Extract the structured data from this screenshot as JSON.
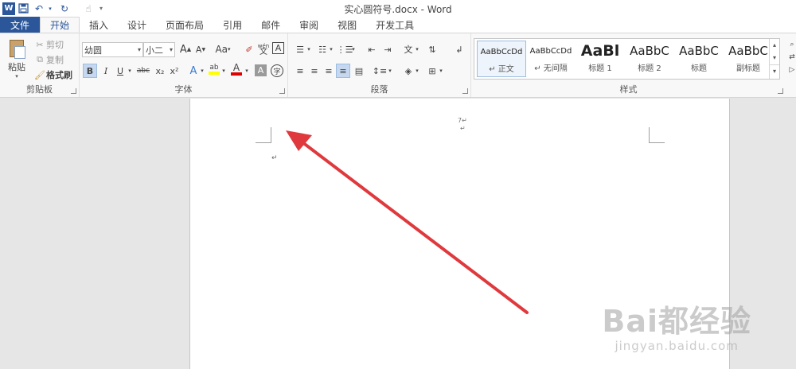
{
  "window": {
    "title": "实心圆符号.docx - Word",
    "qat": {
      "app_icon": "W",
      "save_icon": "save-icon",
      "undo_icon": "undo-icon",
      "redo_icon": "redo-icon",
      "touch_icon": "touch-mode-icon",
      "customize_icon": "customize-qat-icon"
    }
  },
  "tabs": [
    "文件",
    "开始",
    "插入",
    "设计",
    "页面布局",
    "引用",
    "邮件",
    "审阅",
    "视图",
    "开发工具"
  ],
  "active_tab": "开始",
  "clipboard": {
    "paste_label": "粘贴",
    "cut_label": "剪切",
    "copy_label": "复制",
    "format_painter_label": "格式刷",
    "group_label": "剪贴板"
  },
  "font": {
    "font_name": "幼圆",
    "font_size": "小二",
    "group_label": "字体",
    "grow_label": "A",
    "shrink_label": "A",
    "case_label": "Aa",
    "bold": "B",
    "italic": "I",
    "underline": "U",
    "strike": "abc",
    "subscript": "x₂",
    "superscript": "x²",
    "text_effect": "A",
    "highlight": "ab",
    "font_color": "A",
    "char_shading": "A",
    "phonetic_top": "wén",
    "phonetic_bottom": "文",
    "border_char": "A",
    "enclose_char": "字"
  },
  "paragraph": {
    "group_label": "段落"
  },
  "styles": {
    "group_label": "样式",
    "items": [
      {
        "sample": "AaBbCcDd",
        "name": "↵ 正文"
      },
      {
        "sample": "AaBbCcDd",
        "name": "↵ 无间隔"
      },
      {
        "sample": "AaBl",
        "name": "标题 1"
      },
      {
        "sample": "AaBbC",
        "name": "标题 2"
      },
      {
        "sample": "AaBbC",
        "name": "标题"
      },
      {
        "sample": "AaBbC",
        "name": "副标题"
      }
    ]
  },
  "document": {
    "header_mark": "7↵",
    "header_mark2": "↵",
    "para_mark": "↵"
  },
  "watermark": {
    "main": "Bai都经验",
    "sub": "jingyan.baidu.com"
  },
  "colors": {
    "word_blue": "#2b579a",
    "arrow_red": "#e0393d"
  }
}
